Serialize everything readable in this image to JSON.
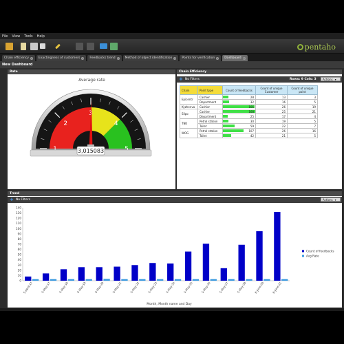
{
  "menu": [
    "File",
    "View",
    "Tools",
    "Help"
  ],
  "brand": {
    "name": "pentaho",
    "color": "#8fb23a"
  },
  "tabs": [
    {
      "label": "Chain efficiency",
      "active": false
    },
    {
      "label": "Exactingness of customers",
      "active": false
    },
    {
      "label": "Feedbacks trend",
      "active": false
    },
    {
      "label": "Method of object identification",
      "active": false
    },
    {
      "label": "Points for verification",
      "active": false
    },
    {
      "label": "Dashboard",
      "active": true
    }
  ],
  "document_title": "New Dashboard",
  "rate_panel": {
    "header": "Rate",
    "title": "Average rate",
    "value": 3.015083,
    "value_text": "3,015083",
    "min": 1,
    "max": 5,
    "ticks": [
      "1",
      "2",
      "3",
      "4",
      "5"
    ],
    "bands": [
      {
        "from": 1,
        "to": 3,
        "color": "#e8221e"
      },
      {
        "from": 3,
        "to": 4,
        "color": "#e7e31b"
      },
      {
        "from": 4,
        "to": 5,
        "color": "#29c11f"
      }
    ]
  },
  "chain_panel": {
    "header": "Chain Efficiency",
    "filters": "No Filters",
    "rows": "Rows: 9",
    "cols": "Cols: 3",
    "actions": "Actions",
    "columns": [
      "Chain",
      "Point type",
      "Count of feedbacks",
      "Count of unique Customer",
      "Count of unique point"
    ],
    "max_feedbacks": 168,
    "groups": [
      {
        "chain": "Epicentr",
        "rows": [
          {
            "point": "Cashier",
            "feedbacks": 28,
            "customers": 13,
            "points": 3
          },
          {
            "point": "Department",
            "feedbacks": 32,
            "customers": 16,
            "points": 5
          }
        ]
      },
      {
        "chain": "Kyzhenva",
        "rows": [
          {
            "point": "Cashier",
            "feedbacks": 166,
            "customers": 26,
            "points": 19
          }
        ]
      },
      {
        "chain": "Silpo",
        "rows": [
          {
            "point": "Cashier",
            "feedbacks": 168,
            "customers": 25,
            "points": 21
          },
          {
            "point": "Department",
            "feedbacks": 25,
            "customers": 17,
            "points": 4
          }
        ]
      },
      {
        "chain": "TNK",
        "rows": [
          {
            "point": "Petrol station",
            "feedbacks": 30,
            "customers": 19,
            "points": 5
          },
          {
            "point": "Toilet",
            "feedbacks": 59,
            "customers": 22,
            "points": 7
          }
        ]
      },
      {
        "chain": "WOG",
        "rows": [
          {
            "point": "Petrol station",
            "feedbacks": 107,
            "customers": 26,
            "points": 16
          },
          {
            "point": "Toilet",
            "feedbacks": 42,
            "customers": 21,
            "points": 5
          }
        ]
      }
    ]
  },
  "trend_panel": {
    "header": "Trend",
    "filters": "No Filters",
    "actions": "Actions"
  },
  "chart_data": {
    "type": "bar",
    "title": "",
    "xlabel": "Month, Month name and Day",
    "ylabel": "",
    "ylim": [
      0,
      140
    ],
    "yticks": [
      0,
      10,
      20,
      30,
      40,
      50,
      60,
      70,
      80,
      90,
      100,
      110,
      120,
      130,
      140
    ],
    "grid": false,
    "legend_position": "right",
    "categories": [
      "5-April-17",
      "5-May-17",
      "5-May-18",
      "5-May-19",
      "5-May-20",
      "5-May-21",
      "5-May-22",
      "5-May-23",
      "5-May-24",
      "5-May-25",
      "5-May-26",
      "5-May-27",
      "5-May-28",
      "6-June-20",
      "6-June-21"
    ],
    "series": [
      {
        "name": "Count of feedbacks",
        "color": "#0000c8",
        "values": [
          8,
          14,
          22,
          26,
          26,
          27,
          30,
          34,
          33,
          56,
          71,
          24,
          69,
          95,
          132
        ]
      },
      {
        "name": "Avg Rate",
        "color": "#3b9be0",
        "values": [
          3,
          3,
          3,
          3,
          3.5,
          3,
          3,
          3,
          3,
          3,
          3,
          3,
          3,
          3,
          3
        ]
      }
    ]
  }
}
